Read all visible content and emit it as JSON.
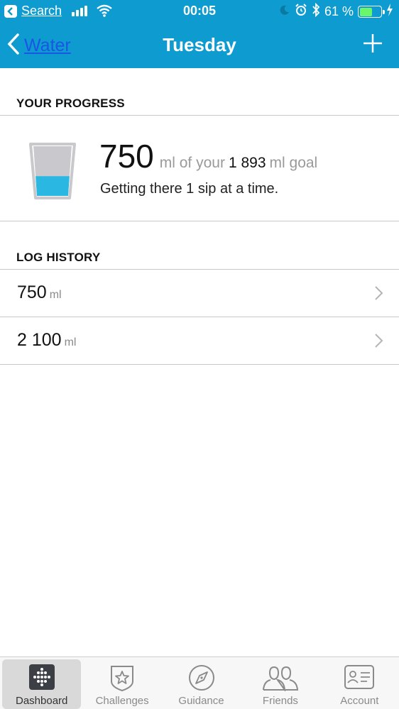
{
  "status_bar": {
    "back_app_label": "Search",
    "time": "00:05",
    "battery_percent": "61 %",
    "battery_level": 0.61
  },
  "nav": {
    "back_label": "Water",
    "title": "Tuesday"
  },
  "progress": {
    "header": "YOUR PROGRESS",
    "amount": "750",
    "of_text": "ml of your",
    "goal_value": "1 893",
    "goal_unit": "ml goal",
    "tagline": "Getting there 1 sip at a time.",
    "fill_fraction": 0.396
  },
  "log": {
    "header": "LOG HISTORY",
    "entries": [
      {
        "value": "750",
        "unit": "ml"
      },
      {
        "value": "2 100",
        "unit": "ml"
      }
    ]
  },
  "tabs": [
    {
      "label": "Dashboard",
      "active": true
    },
    {
      "label": "Challenges",
      "active": false
    },
    {
      "label": "Guidance",
      "active": false
    },
    {
      "label": "Friends",
      "active": false
    },
    {
      "label": "Account",
      "active": false
    }
  ],
  "colors": {
    "nav_background": "#0d9bd0",
    "water_fill": "#2ab8e3",
    "battery_fill": "#6bf56b"
  }
}
